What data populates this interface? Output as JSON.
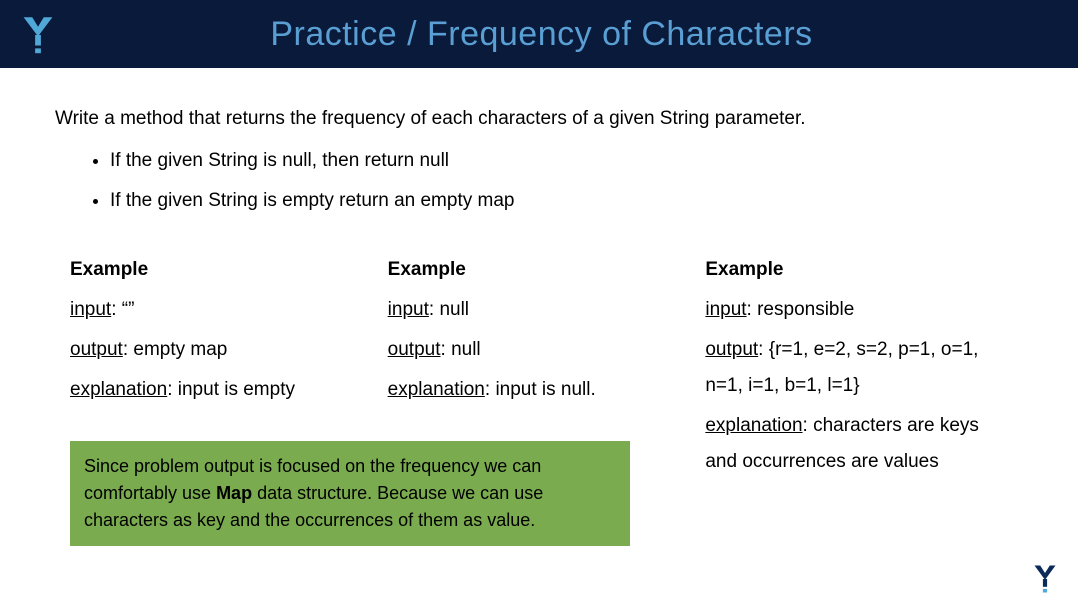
{
  "header": {
    "title": "Practice / Frequency of Characters"
  },
  "intro": "Write a method that returns the frequency of each characters of a given String parameter.",
  "bullets": [
    "If the given String is null, then return null",
    "If the given String is empty return an empty map"
  ],
  "labels": {
    "example": "Example",
    "input": "input",
    "output": "output",
    "explanation": "explanation"
  },
  "examples": [
    {
      "input": "“”",
      "output": "empty map",
      "explanation": "input is empty"
    },
    {
      "input": "null",
      "output": "null",
      "explanation": "input is null."
    },
    {
      "input": "responsible",
      "output": "{r=1, e=2, s=2, p=1, o=1, n=1, i=1, b=1, l=1}",
      "explanation": "characters are keys and occurrences are values"
    }
  ],
  "hint": {
    "pre": "Since problem output is focused on the frequency we can comfortably use ",
    "bold": "Map",
    "post": " data structure. Because we can use characters as key and the occurrences of them as value."
  },
  "colors": {
    "header_bg": "#0a1a3a",
    "title_color": "#5a9fd4",
    "hint_bg": "#7aab4f",
    "logo_color": "#4fa8d8"
  }
}
